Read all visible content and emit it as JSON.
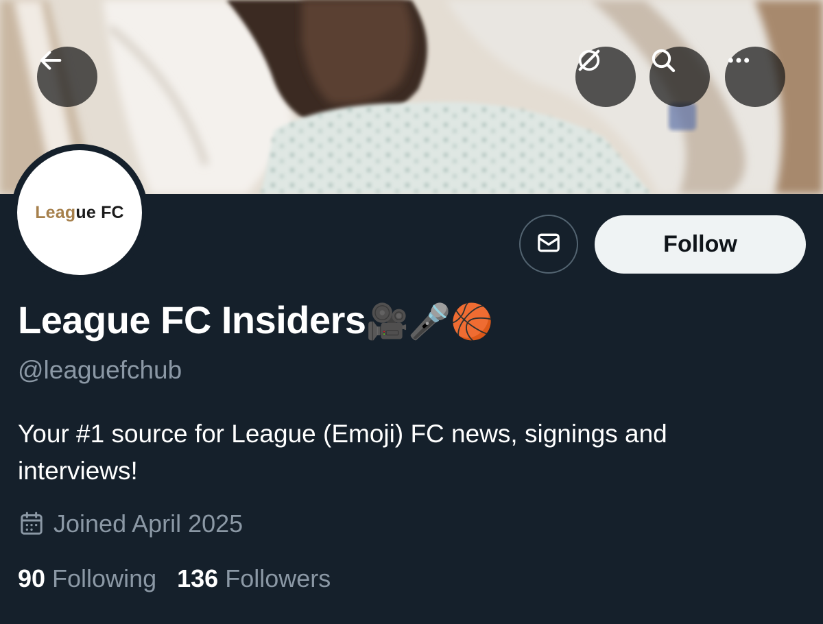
{
  "header": {
    "icons": {
      "back": "arrow-left-icon",
      "grok": "grok-icon",
      "search": "search-icon",
      "more": "more-icon"
    }
  },
  "profile": {
    "avatar": {
      "logo_part1": "Leag",
      "logo_part2": "ue FC",
      "logo_colors": [
        "#a6804c",
        "#1b1b1b"
      ]
    },
    "message_icon": "envelope-icon",
    "follow_label": "Follow",
    "display_name": "League FC Insiders",
    "name_emojis": "🎥🎤🏀",
    "handle": "@leaguefchub",
    "bio": "Your #1 source for League (Emoji) FC news, signings and interviews!",
    "joined_icon": "calendar-icon",
    "joined": "Joined April 2025",
    "following_count": "90",
    "following_label": "Following",
    "followers_count": "136",
    "followers_label": "Followers"
  },
  "colors": {
    "background": "#15202b",
    "secondary_text": "#8b98a5",
    "follow_button": "#eff3f4",
    "follow_text": "#0f1419"
  }
}
